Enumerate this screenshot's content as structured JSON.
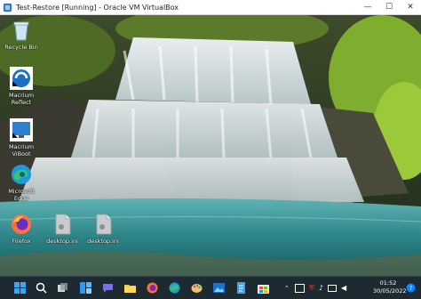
{
  "window": {
    "title": "Test-Restore [Running] - Oracle VM VirtualBox",
    "controls": {
      "minimize": "—",
      "maximize": "☐",
      "close": "✕"
    }
  },
  "desktop_icons": [
    {
      "label": "Recycle Bin",
      "icon": "recycle-bin-icon"
    },
    {
      "label": "Macrium\nReflect",
      "icon": "macrium-reflect-icon"
    },
    {
      "label": "Macrium\nViBoot",
      "icon": "macrium-viboot-icon"
    },
    {
      "label": "Microsoft\nEdge",
      "icon": "edge-icon"
    },
    {
      "label": "Firefox",
      "icon": "firefox-icon"
    },
    {
      "label": "desktop.ini",
      "icon": "file-icon"
    },
    {
      "label": "desktop.ini",
      "icon": "file-icon"
    }
  ],
  "taskbar": {
    "apps": [
      "start-icon",
      "search-icon",
      "task-view-icon",
      "widgets-icon",
      "chat-icon",
      "file-explorer-icon",
      "firefox-icon",
      "edge-icon",
      "paint-icon",
      "photos-icon",
      "notepad-icon",
      "store-icon"
    ],
    "clock_time": "01:52",
    "clock_date": "30/05/2022",
    "colors": {
      "bar": "#1d2a32",
      "accent": "#0a84ff"
    }
  }
}
